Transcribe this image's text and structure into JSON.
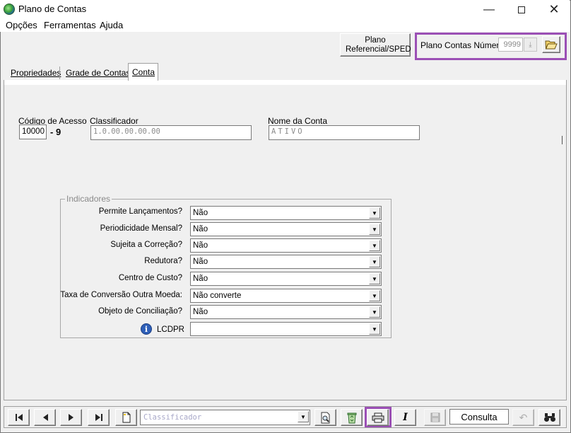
{
  "window": {
    "title": "Plano de Contas"
  },
  "menu": [
    "Opções",
    "Ferramentas",
    "Ajuda"
  ],
  "header": {
    "plano_button_label": "Plano Referencial/SPED",
    "plano_contas_label": "Plano Contas Número",
    "plano_contas_value": "9999"
  },
  "tabs": [
    {
      "label": "Propriedades",
      "active": false
    },
    {
      "label": "Grade de Contas",
      "active": false
    },
    {
      "label": "Conta",
      "active": true
    }
  ],
  "form": {
    "codigo_label": "Código de Acesso",
    "codigo_value": "10000",
    "codigo_digit": "- 9",
    "classificador_label": "Classificador",
    "classificador_value": "1.0.00.00.00.00",
    "nome_label": "Nome da Conta",
    "nome_value": "ATIVO"
  },
  "indicadores": {
    "title": "Indicadores",
    "rows": [
      {
        "label": "Permite Lançamentos?",
        "value": "Não"
      },
      {
        "label": "Periodicidade Mensal?",
        "value": "Não"
      },
      {
        "label": "Sujeita a Correção?",
        "value": "Não"
      },
      {
        "label": "Redutora?",
        "value": "Não"
      },
      {
        "label": "Centro de Custo?",
        "value": "Não"
      },
      {
        "label": "Taxa de Conversão Outra Moeda:",
        "value": "Não converte"
      },
      {
        "label": "Objeto de Conciliação?",
        "value": "Não"
      },
      {
        "label": "LCDPR",
        "value": ""
      }
    ]
  },
  "toolbar": {
    "search_placeholder": "Classificador",
    "mode_label": "Consulta"
  },
  "colors": {
    "highlight": "#9b4fb5",
    "info_icon": "#2e5fb8"
  }
}
